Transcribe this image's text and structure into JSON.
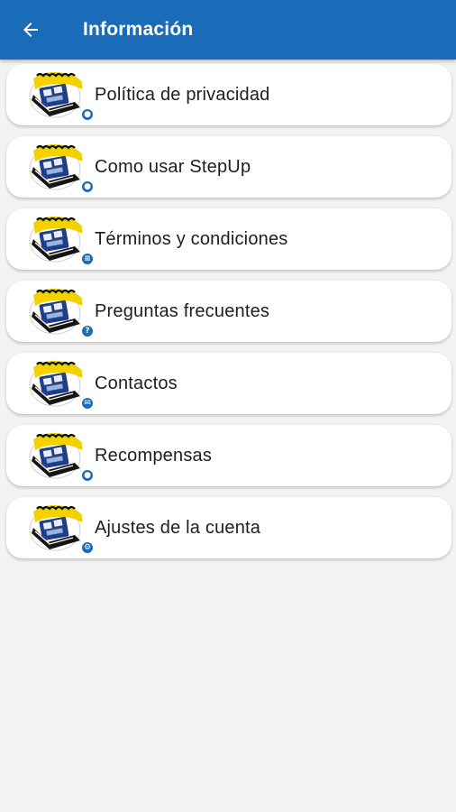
{
  "header": {
    "title": "Información",
    "back_icon": "arrow-left-icon"
  },
  "colors": {
    "app_bar": "#1a6bb8",
    "background": "#f3f3f3",
    "card": "#ffffff",
    "logo_yellow": "#f2d200"
  },
  "menu": {
    "items": [
      {
        "label": "Política de privacidad",
        "badge_icon": "shield-icon",
        "badge_glyph": "●"
      },
      {
        "label": "Como usar StepUp",
        "badge_icon": "info-icon",
        "badge_glyph": "●"
      },
      {
        "label": "Términos y condiciones",
        "badge_icon": "document-icon",
        "badge_glyph": "≡"
      },
      {
        "label": "Preguntas frecuentes",
        "badge_icon": "question-icon",
        "badge_glyph": "?"
      },
      {
        "label": "Contactos",
        "badge_icon": "mail-icon",
        "badge_glyph": "✉"
      },
      {
        "label": "Recompensas",
        "badge_icon": "reward-icon",
        "badge_glyph": "●"
      },
      {
        "label": "Ajustes de la cuenta",
        "badge_icon": "settings-icon",
        "badge_glyph": "⚙"
      }
    ]
  }
}
